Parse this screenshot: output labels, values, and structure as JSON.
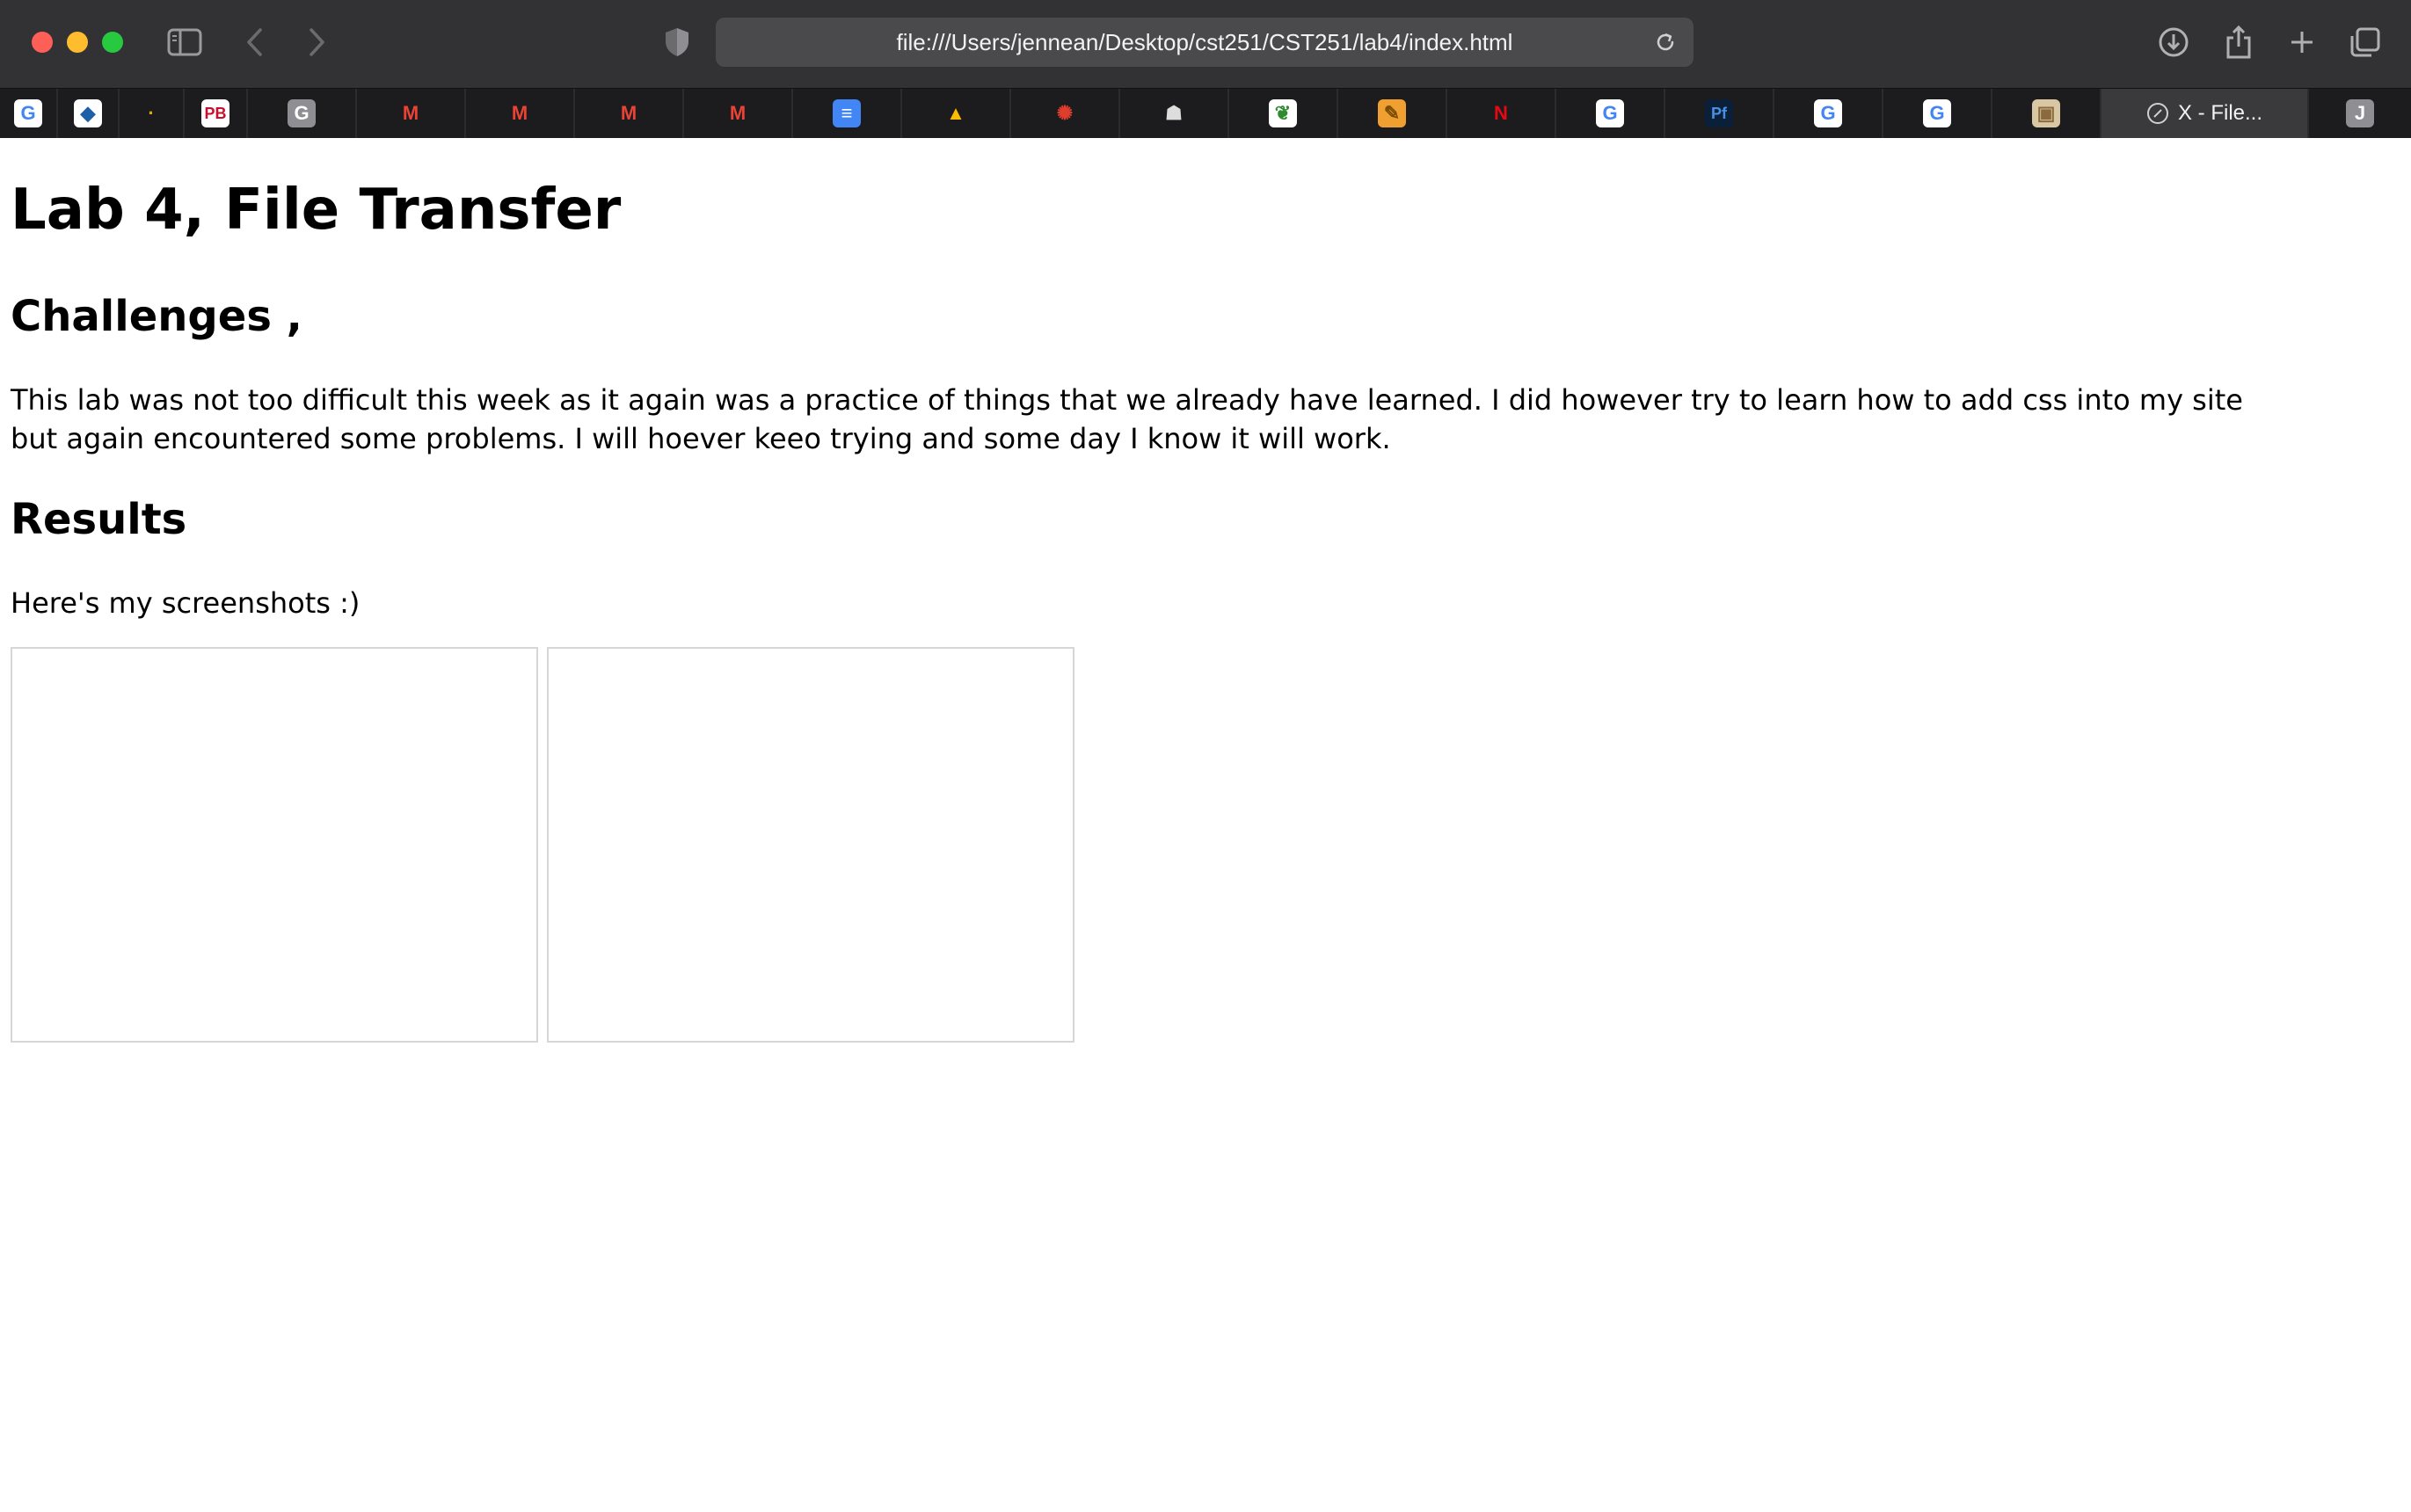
{
  "browser": {
    "url": "file:///Users/jennean/Desktop/cst251/CST251/lab4/index.html",
    "tabs": [
      {
        "icon": "google-icon",
        "glyph": "G",
        "color": "#4285f4",
        "bg": "#ffffff"
      },
      {
        "icon": "app-logo-icon",
        "glyph": "◆",
        "color": "#1d5fa8",
        "bg": "#ffffff"
      },
      {
        "icon": "dark-app-icon",
        "glyph": "·",
        "color": "#e0a800",
        "bg": "#1c1c1e"
      },
      {
        "icon": "pb-icon",
        "glyph": "PB",
        "color": "#c8102e",
        "bg": "#ffffff"
      },
      {
        "icon": "g-letter-icon",
        "glyph": "G",
        "color": "#ffffff",
        "bg": "#8e8e93"
      },
      {
        "icon": "gmail-icon",
        "glyph": "M",
        "color": "#ea4335",
        "bg": "transparent"
      },
      {
        "icon": "gmail-icon",
        "glyph": "M",
        "color": "#ea4335",
        "bg": "transparent"
      },
      {
        "icon": "gmail-icon",
        "glyph": "M",
        "color": "#ea4335",
        "bg": "transparent"
      },
      {
        "icon": "gmail-icon",
        "glyph": "M",
        "color": "#ea4335",
        "bg": "transparent"
      },
      {
        "icon": "google-docs-icon",
        "glyph": "≡",
        "color": "#ffffff",
        "bg": "#4285f4"
      },
      {
        "icon": "google-drive-icon",
        "glyph": "▲",
        "color": "#fbbc04",
        "bg": "transparent"
      },
      {
        "icon": "canvas-icon",
        "glyph": "✺",
        "color": "#e03e2d",
        "bg": "transparent"
      },
      {
        "icon": "wolf-icon",
        "glyph": "☗",
        "color": "#dddddd",
        "bg": "transparent"
      },
      {
        "icon": "leaf-app-icon",
        "glyph": "❦",
        "color": "#2e8b2e",
        "bg": "#ffffff"
      },
      {
        "icon": "notes-icon",
        "glyph": "✎",
        "color": "#7a4b00",
        "bg": "#f0a030"
      },
      {
        "icon": "netflix-icon",
        "glyph": "N",
        "color": "#e50914",
        "bg": "transparent"
      },
      {
        "icon": "google-icon",
        "glyph": "G",
        "color": "#4285f4",
        "bg": "#ffffff"
      },
      {
        "icon": "pf-icon",
        "glyph": "Pf",
        "color": "#4a90e2",
        "bg": "#0a1f3a"
      },
      {
        "icon": "google-icon",
        "glyph": "G",
        "color": "#4285f4",
        "bg": "#ffffff"
      },
      {
        "icon": "google-icon",
        "glyph": "G",
        "color": "#4285f4",
        "bg": "#ffffff"
      },
      {
        "icon": "photo-icon",
        "glyph": "▣",
        "color": "#8b6b3e",
        "bg": "#d9c7a3"
      }
    ],
    "active_tab_title": "X - File...",
    "last_tab_glyph": "J"
  },
  "page": {
    "title": "Lab 4, File Transfer",
    "challenges_heading": "Challenges ,",
    "challenges_text": "This lab was not too difficult this week as it again was a practice of things that we already have learned. I did however try to learn how to add css into my site but again encountered some problems. I will hoever keeo trying and some day I know it will work.",
    "results_heading": "Results",
    "results_text": "Here's my screenshots :)"
  }
}
